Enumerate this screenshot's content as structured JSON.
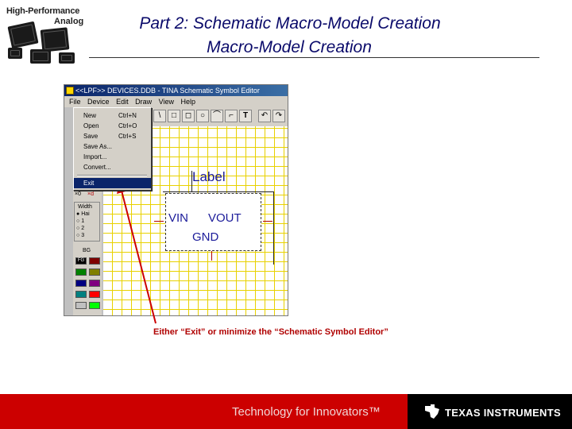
{
  "logo": {
    "title": "High-Performance",
    "subtitle": "Analog"
  },
  "slide": {
    "title_line1": "Part 2: Schematic Macro-Model Creation",
    "title_line2": "Macro-Model Creation",
    "caption": "Either “Exit” or minimize the “Schematic Symbol Editor”"
  },
  "window": {
    "title": "<<LPF>> DEVICES.DDB - TINA Schematic Symbol Editor",
    "menu": [
      "File",
      "Device",
      "Edit",
      "Draw",
      "View",
      "Help"
    ],
    "toolbar": [
      "\\",
      "□",
      "◻",
      "○",
      "⌒",
      "⌐",
      "T",
      "↶",
      "↷"
    ]
  },
  "file_menu": {
    "items": [
      {
        "label": "New",
        "shortcut": "Ctrl+N"
      },
      {
        "label": "Open",
        "shortcut": "Ctrl+O"
      },
      {
        "label": "Save",
        "shortcut": "Ctrl+S"
      },
      {
        "label": "Save As...",
        "shortcut": ""
      },
      {
        "label": "Import...",
        "shortcut": ""
      },
      {
        "label": "Convert...",
        "shortcut": ""
      },
      {
        "label": "Exit",
        "shortcut": ""
      }
    ],
    "selected": "Exit"
  },
  "panel": {
    "zoom_buttons": [
      "×0",
      "×d"
    ],
    "width_label": "Width",
    "width_options": [
      "Hai",
      "1",
      "2",
      "3"
    ],
    "fill_label": "BG",
    "fg_label": "FG",
    "colors": [
      "#7f0000",
      "#008000",
      "#7f7f00",
      "#000080",
      "#800080",
      "#008080",
      "#ff0000",
      "#c0c0c0",
      "#00ff00"
    ]
  },
  "symbol": {
    "label": "Label",
    "pin_in": "VIN",
    "pin_out": "VOUT",
    "pin_gnd": "GND"
  },
  "footer": {
    "tagline": "Technology for Innovators™",
    "company": "TEXAS INSTRUMENTS"
  },
  "colors": {
    "title": "#0a0a6a",
    "caption": "#b00000",
    "footer_red": "#cc0000",
    "grid": "#e8d100"
  }
}
